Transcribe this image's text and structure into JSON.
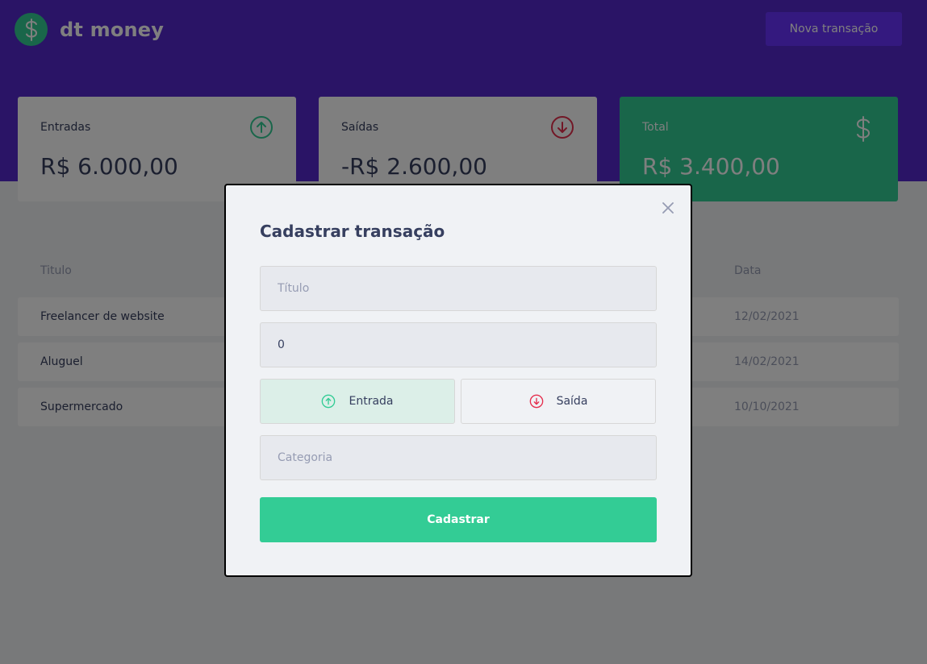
{
  "app": {
    "logo_text": "dt money",
    "new_button": "Nova transação"
  },
  "summary": {
    "income": {
      "label": "Entradas",
      "amount": "R$ 6.000,00"
    },
    "outcome": {
      "label": "Saídas",
      "amount": "-R$ 2.600,00"
    },
    "total": {
      "label": "Total",
      "amount": "R$ 3.400,00"
    }
  },
  "table": {
    "headers": {
      "title": "Titulo",
      "date": "Data"
    },
    "rows": [
      {
        "title": "Freelancer de website",
        "date": "12/02/2021"
      },
      {
        "title": "Aluguel",
        "date": "14/02/2021"
      },
      {
        "title": "Supermercado",
        "date": "10/10/2021"
      }
    ]
  },
  "modal": {
    "title": "Cadastrar transação",
    "title_placeholder": "Título",
    "amount_value": "0",
    "income_label": "Entrada",
    "outcome_label": "Saída",
    "category_placeholder": "Categoria",
    "submit_label": "Cadastrar"
  },
  "colors": {
    "brand": "#5429cc",
    "accent": "#6933ff",
    "green": "#33cc95",
    "red": "#e52e4d"
  },
  "icons": {
    "logo": "dollar-icon",
    "income": "arrow-up-circle-icon",
    "outcome": "arrow-down-circle-icon",
    "total": "dollar-icon",
    "close": "close-icon"
  }
}
